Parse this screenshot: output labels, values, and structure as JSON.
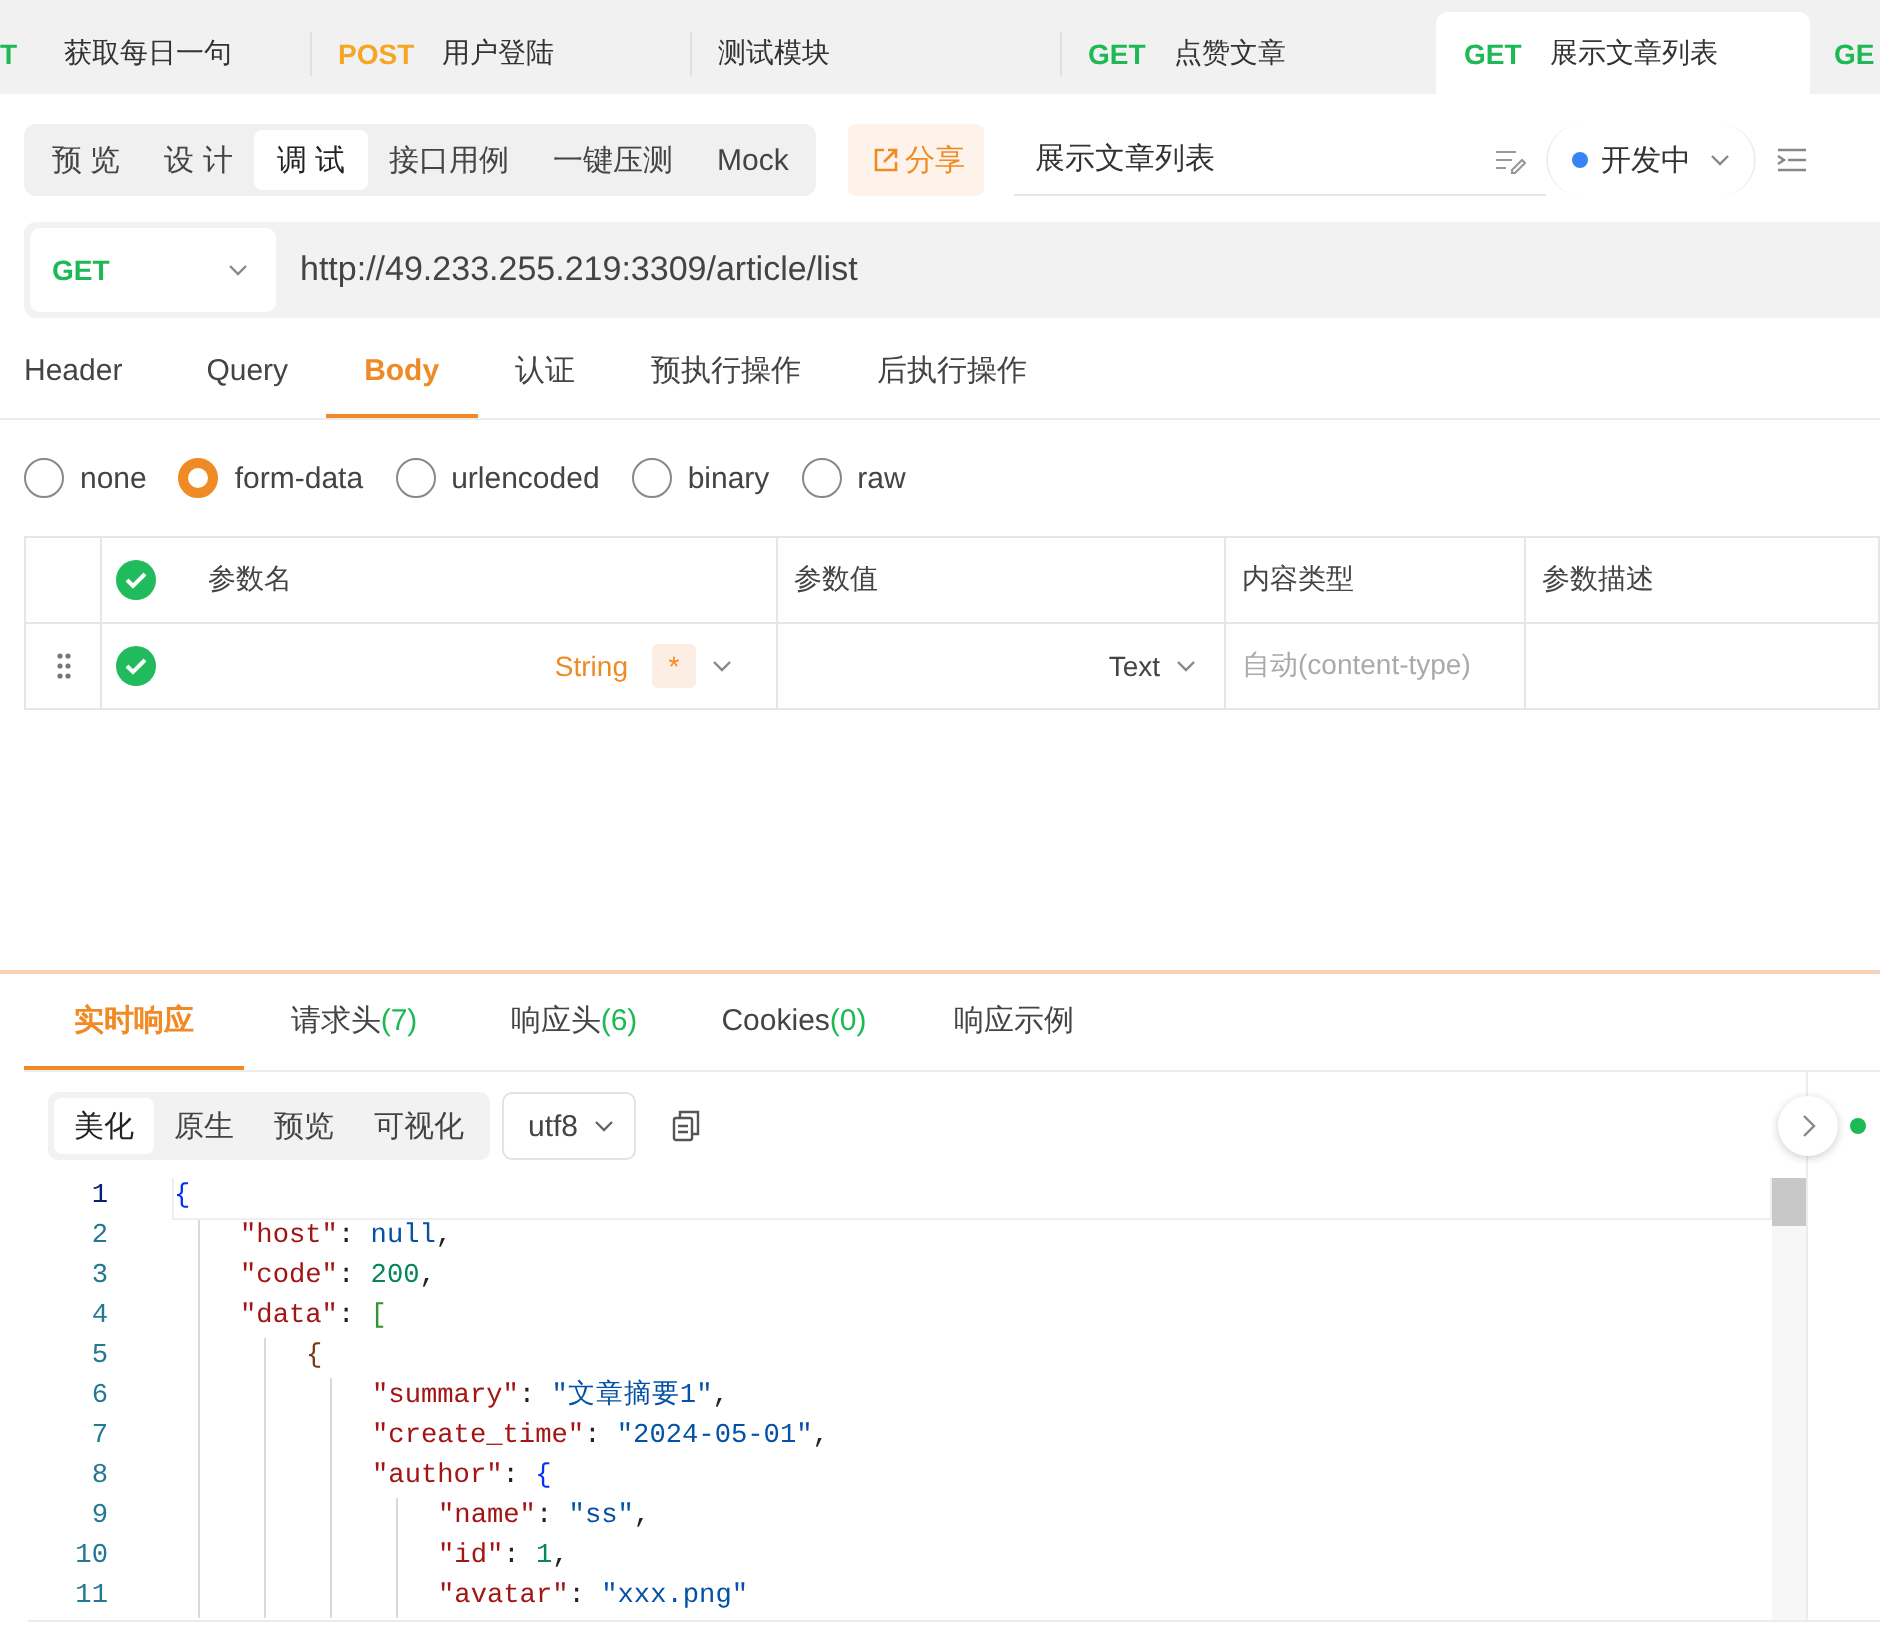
{
  "request_tabs": [
    {
      "method": "T",
      "color": "#1db954",
      "name": "获取每日一句",
      "selected": false
    },
    {
      "method": "POST",
      "color": "#f5a623",
      "name": "用户登陆",
      "selected": false
    },
    {
      "name": "测试模块",
      "selected": false
    },
    {
      "method": "GET",
      "color": "#1db954",
      "name": "点赞文章",
      "selected": false
    },
    {
      "method": "GET",
      "color": "#1db954",
      "name": "展示文章列表",
      "selected": true
    },
    {
      "method": "GE",
      "color": "#1db954",
      "selected": false
    }
  ],
  "mode_tabs": [
    {
      "label": "预 览",
      "selected": false
    },
    {
      "label": "设 计",
      "selected": false
    },
    {
      "label": "调 试",
      "selected": true
    },
    {
      "label": "接口用例",
      "selected": false
    },
    {
      "label": "一键压测",
      "selected": false
    },
    {
      "label": "Mock",
      "selected": false
    }
  ],
  "share_button": "分享",
  "api_name": {
    "value": "展示文章列表"
  },
  "status": {
    "label": "开发中",
    "color": "#3b82f6"
  },
  "url_bar": {
    "method": "GET",
    "url": "http://49.233.255.219:3309/article/list"
  },
  "param_tabs": [
    {
      "label": "Header",
      "selected": false
    },
    {
      "label": "Query",
      "selected": false
    },
    {
      "label": "Body",
      "selected": true
    },
    {
      "label": "认证",
      "selected": false
    },
    {
      "label": "预执行操作",
      "selected": false
    },
    {
      "label": "后执行操作",
      "selected": false
    }
  ],
  "body_types": [
    {
      "label": "none",
      "selected": false
    },
    {
      "label": "form-data",
      "selected": true
    },
    {
      "label": "urlencoded",
      "selected": false
    },
    {
      "label": "binary",
      "selected": false
    },
    {
      "label": "raw",
      "selected": false
    }
  ],
  "param_table": {
    "all_checked": true,
    "columns": [
      "参数名",
      "参数值",
      "内容类型",
      "参数描述"
    ],
    "rows": [
      {
        "checked": true,
        "type": "String",
        "required": "*",
        "value_type": "Text",
        "content_type_placeholder": "自动(content-type)"
      }
    ]
  },
  "response_tabs": [
    {
      "label": "实时响应",
      "selected": true
    },
    {
      "label": "请求头",
      "count": "(7)",
      "selected": false
    },
    {
      "label": "响应头",
      "count": "(6)",
      "selected": false
    },
    {
      "label": "Cookies",
      "count": "(0)",
      "selected": false
    },
    {
      "label": "响应示例",
      "selected": false
    }
  ],
  "view_modes": [
    {
      "label": "美化",
      "selected": true
    },
    {
      "label": "原生",
      "selected": false
    },
    {
      "label": "预览",
      "selected": false
    },
    {
      "label": "可视化",
      "selected": false
    }
  ],
  "encoding": "utf8",
  "code_lines": [
    {
      "number": "1",
      "tokens": [
        {
          "kind": "bracket",
          "text": "{",
          "color": "#0431fa"
        }
      ],
      "children": [
        {
          "number": "2",
          "tokens": [
            {
              "kind": "key",
              "text": "\"host\""
            },
            {
              "kind": "punct",
              "text": ": "
            },
            {
              "kind": "keyword",
              "text": "null"
            },
            {
              "kind": "punct",
              "text": ","
            }
          ]
        },
        {
          "number": "3",
          "tokens": [
            {
              "kind": "key",
              "text": "\"code\""
            },
            {
              "kind": "punct",
              "text": ": "
            },
            {
              "kind": "number",
              "text": "200"
            },
            {
              "kind": "punct",
              "text": ","
            }
          ]
        },
        {
          "number": "4",
          "tokens": [
            {
              "kind": "key",
              "text": "\"data\""
            },
            {
              "kind": "punct",
              "text": ": "
            },
            {
              "kind": "bracket",
              "text": "[",
              "color": "#319331"
            }
          ],
          "children": [
            {
              "number": "5",
              "tokens": [
                {
                  "kind": "bracket",
                  "text": "{",
                  "color": "#7b3814"
                }
              ],
              "children": [
                {
                  "number": "6",
                  "tokens": [
                    {
                      "kind": "key",
                      "text": "\"summary\""
                    },
                    {
                      "kind": "punct",
                      "text": ": "
                    },
                    {
                      "kind": "string",
                      "text": "\"文章摘要1\""
                    },
                    {
                      "kind": "punct",
                      "text": ","
                    }
                  ]
                },
                {
                  "number": "7",
                  "tokens": [
                    {
                      "kind": "key",
                      "text": "\"create_time\""
                    },
                    {
                      "kind": "punct",
                      "text": ": "
                    },
                    {
                      "kind": "string",
                      "text": "\"2024-05-01\""
                    },
                    {
                      "kind": "punct",
                      "text": ","
                    }
                  ]
                },
                {
                  "number": "8",
                  "tokens": [
                    {
                      "kind": "key",
                      "text": "\"author\""
                    },
                    {
                      "kind": "punct",
                      "text": ": "
                    },
                    {
                      "kind": "bracket",
                      "text": "{",
                      "color": "#0431fa"
                    }
                  ],
                  "children": [
                    {
                      "number": "9",
                      "tokens": [
                        {
                          "kind": "key",
                          "text": "\"name\""
                        },
                        {
                          "kind": "punct",
                          "text": ": "
                        },
                        {
                          "kind": "string",
                          "text": "\"ss\""
                        },
                        {
                          "kind": "punct",
                          "text": ","
                        }
                      ]
                    },
                    {
                      "number": "10",
                      "tokens": [
                        {
                          "kind": "key",
                          "text": "\"id\""
                        },
                        {
                          "kind": "punct",
                          "text": ": "
                        },
                        {
                          "kind": "number",
                          "text": "1"
                        },
                        {
                          "kind": "punct",
                          "text": ","
                        }
                      ]
                    },
                    {
                      "number": "11",
                      "tokens": [
                        {
                          "kind": "key",
                          "text": "\"avatar\""
                        },
                        {
                          "kind": "punct",
                          "text": ": "
                        },
                        {
                          "kind": "string",
                          "text": "\"xxx.png\""
                        }
                      ]
                    }
                  ]
                }
              ]
            }
          ]
        }
      ]
    }
  ]
}
